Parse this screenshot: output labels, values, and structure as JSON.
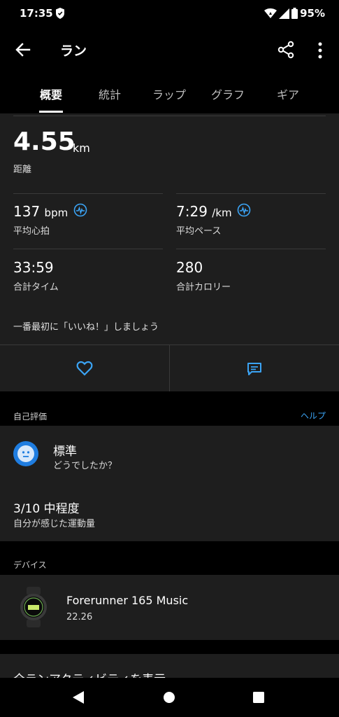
{
  "status": {
    "time": "17:35",
    "battery": "95%"
  },
  "appbar": {
    "title": "ラン"
  },
  "tabs": [
    "概要",
    "統計",
    "ラップ",
    "グラフ",
    "ギア"
  ],
  "summary": {
    "distance": {
      "value": "4.55",
      "unit": "km",
      "label": "距離"
    },
    "heart_rate": {
      "value": "137",
      "unit": "bpm",
      "label": "平均心拍"
    },
    "pace": {
      "value": "7:29",
      "unit": "/km",
      "label": "平均ペース"
    },
    "time": {
      "value": "33:59",
      "label": "合計タイム"
    },
    "calories": {
      "value": "280",
      "label": "合計カロリー"
    },
    "like_prompt": "一番最初に「いいね！」しましょう"
  },
  "self_eval": {
    "header": "自己評価",
    "help": "ヘルプ",
    "feel_title": "標準",
    "feel_sub": "どうでしたか？",
    "effort_title": "3/10 中程度",
    "effort_sub": "自分が感じた運動量"
  },
  "device": {
    "header": "デバイス",
    "name": "Forerunner 165 Music",
    "version": "22.26"
  },
  "footer": {
    "partial_text": "全ランアクティビティを表示"
  },
  "colors": {
    "accent": "#3ba4f5",
    "card": "#1e1e1e",
    "face": "#1f7de0"
  }
}
